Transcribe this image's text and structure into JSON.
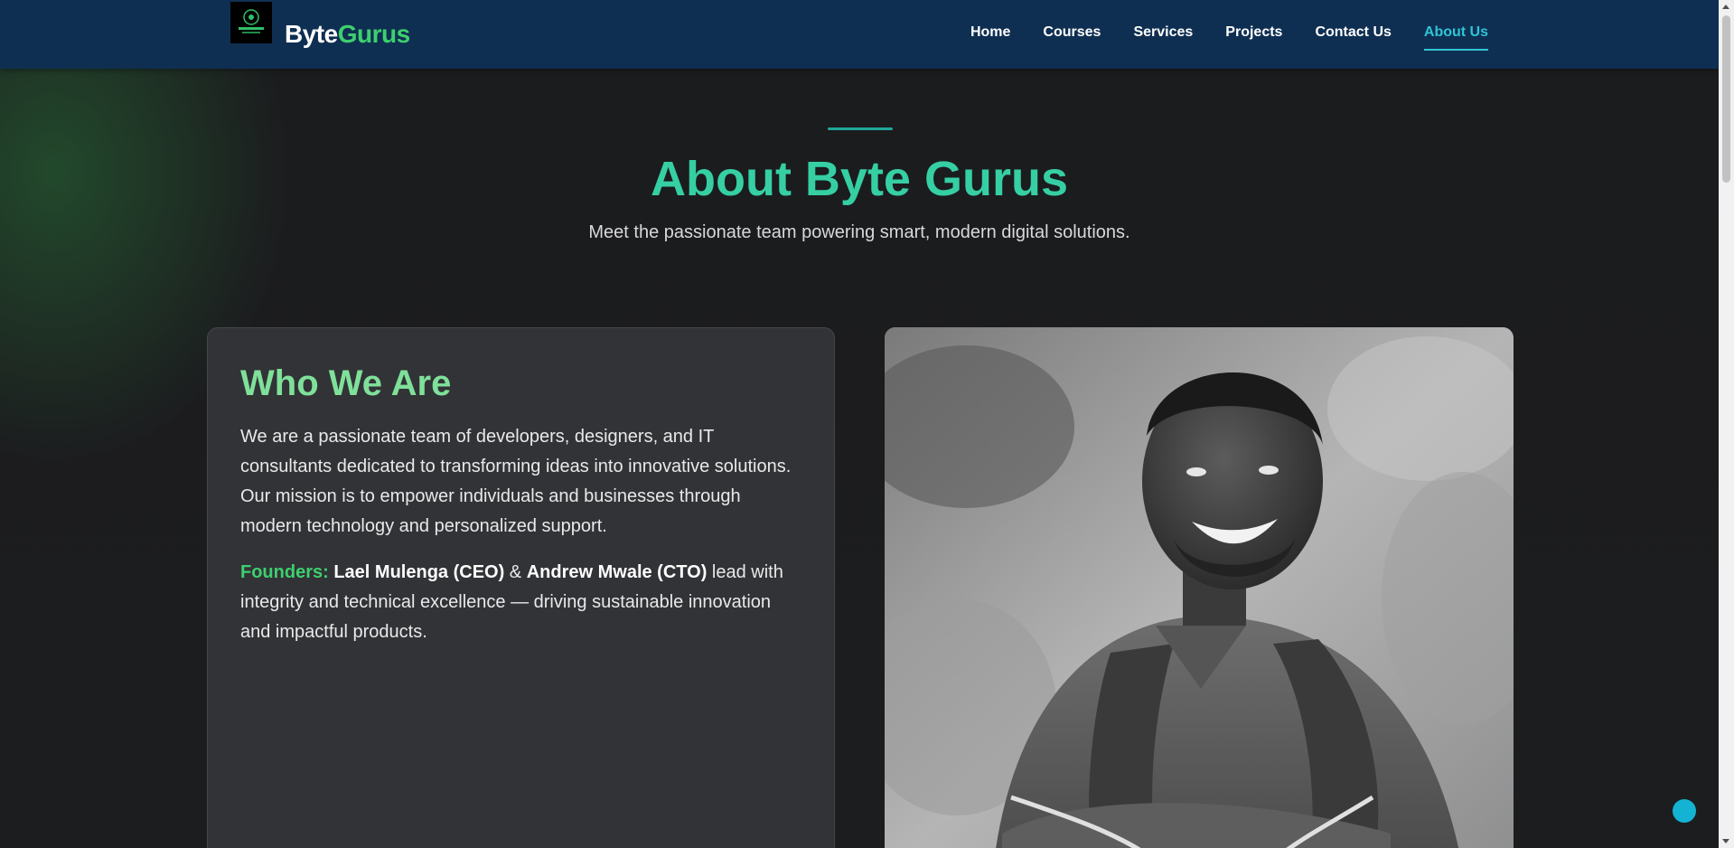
{
  "header": {
    "brand_part1": "Byte",
    "brand_part2": "Gurus",
    "logo_icon": "bytegurus-logo-icon",
    "nav": [
      {
        "label": "Home",
        "active": false
      },
      {
        "label": "Courses",
        "active": false
      },
      {
        "label": "Services",
        "active": false
      },
      {
        "label": "Projects",
        "active": false
      },
      {
        "label": "Contact Us",
        "active": false
      },
      {
        "label": "About Us",
        "active": true
      }
    ]
  },
  "hero": {
    "title": "About Byte Gurus",
    "subtitle": "Meet the passionate team powering smart, modern digital solutions."
  },
  "about_card": {
    "heading": "Who We Are",
    "description": "We are a passionate team of developers, designers, and IT consultants dedicated to transforming ideas into innovative solutions. Our mission is to empower individuals and businesses through modern technology and personalized support.",
    "founders_label": "Founders:",
    "founder1": "Lael Mulenga (CEO)",
    "amp": " & ",
    "founder2": "Andrew Mwale (CTO)",
    "founders_text": " lead with integrity and technical excellence — driving sustainable innovation and impactful products."
  },
  "colors": {
    "navbar_bg": "#0f2f52",
    "accent_teal": "#35cfa3",
    "accent_green": "#3ecf6e",
    "active_nav": "#2fc4d6",
    "card_bg": "#323336",
    "page_bg": "#1b1c1e"
  }
}
